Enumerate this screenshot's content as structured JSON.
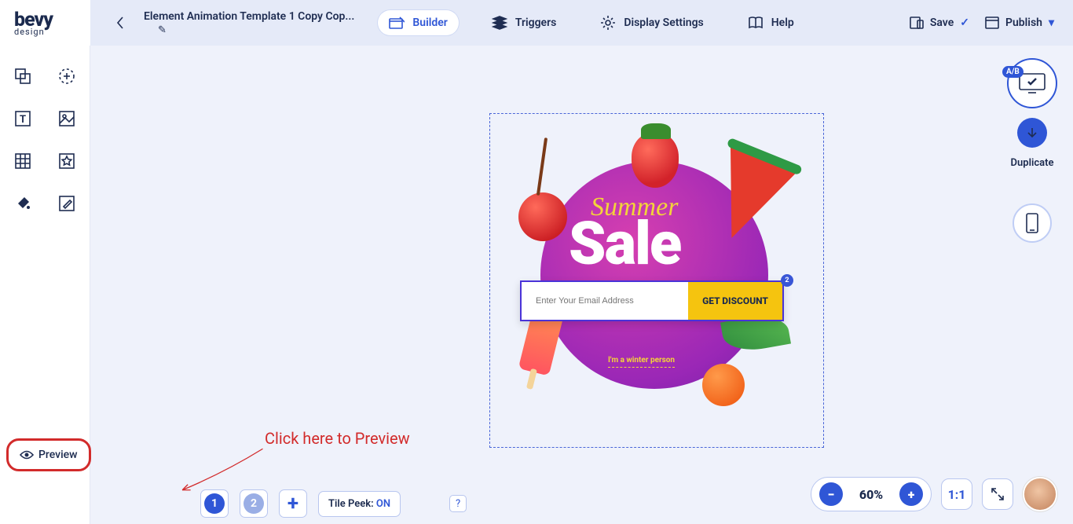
{
  "logo": {
    "main": "bevy",
    "sub": "design"
  },
  "document": {
    "title": "Element Animation Template 1 Copy Cop...",
    "edit_icon": "✎"
  },
  "tabs": {
    "builder": "Builder",
    "triggers": "Triggers",
    "display": "Display Settings",
    "help": "Help"
  },
  "actions": {
    "save": "Save",
    "publish": "Publish"
  },
  "sale": {
    "summer": "Summer",
    "sale": "Sale",
    "email_ph": "Enter Your Email Address",
    "btn": "GET DISCOUNT",
    "badge": "2",
    "winter": "I'm a winter person"
  },
  "rail": {
    "ab": "A/B",
    "duplicate": "Duplicate"
  },
  "annotation": {
    "text": "Click here to Preview"
  },
  "preview_btn": "Preview",
  "tiles": {
    "one": "1",
    "two": "2",
    "peek": "Tile Peek:",
    "peek_val": "ON"
  },
  "help_q": "?",
  "zoom": {
    "minus": "−",
    "val": "60%",
    "plus": "+",
    "fit": "1:1"
  }
}
